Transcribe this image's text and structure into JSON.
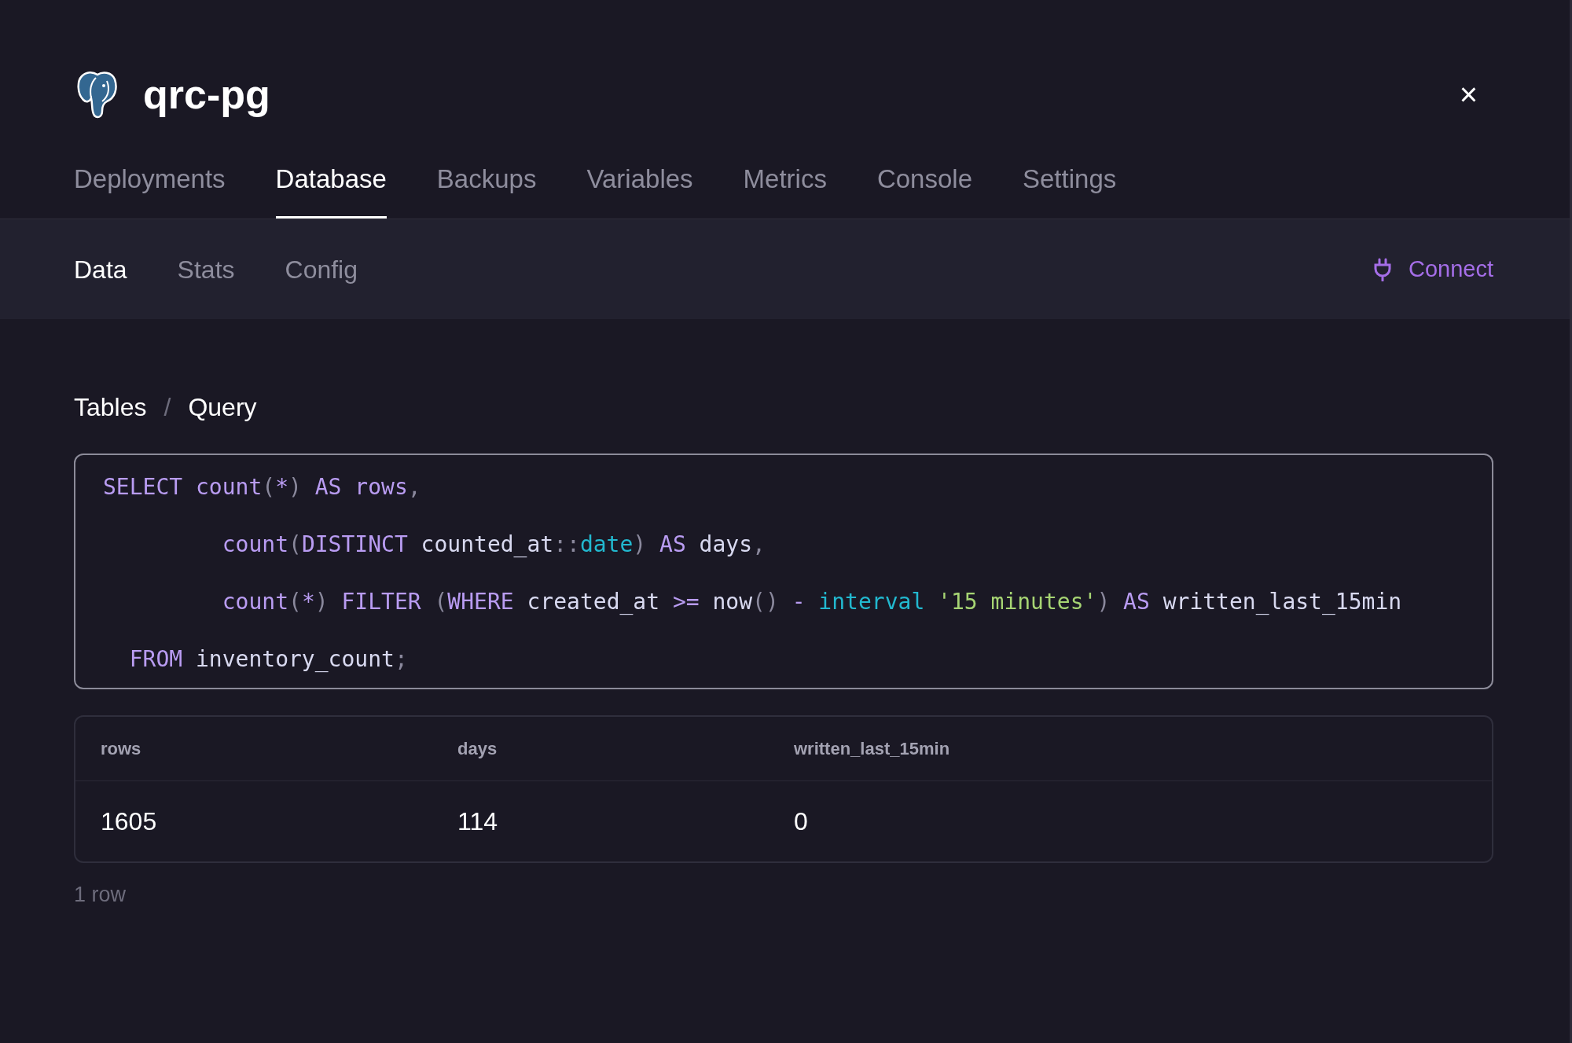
{
  "header": {
    "title": "qrc-pg",
    "close_label": "×"
  },
  "tabs": [
    {
      "label": "Deployments",
      "selected": false
    },
    {
      "label": "Database",
      "selected": true
    },
    {
      "label": "Backups",
      "selected": false
    },
    {
      "label": "Variables",
      "selected": false
    },
    {
      "label": "Metrics",
      "selected": false
    },
    {
      "label": "Console",
      "selected": false
    },
    {
      "label": "Settings",
      "selected": false
    }
  ],
  "subtabs": [
    {
      "label": "Data",
      "selected": true
    },
    {
      "label": "Stats",
      "selected": false
    },
    {
      "label": "Config",
      "selected": false
    }
  ],
  "connect_button": {
    "label": "Connect"
  },
  "breadcrumb": {
    "items": [
      "Tables",
      "Query"
    ],
    "separator": "/"
  },
  "query": {
    "lines": [
      [
        {
          "text": "SELECT",
          "kind": "keyword"
        },
        {
          "text": " count",
          "kind": "function"
        },
        {
          "text": "(",
          "kind": "punct"
        },
        {
          "text": "*",
          "kind": "operator"
        },
        {
          "text": ")",
          "kind": "punct"
        },
        {
          "text": " AS rows",
          "kind": "keyword"
        },
        {
          "text": ",",
          "kind": "punct"
        }
      ],
      [
        {
          "text": "         count",
          "kind": "function"
        },
        {
          "text": "(",
          "kind": "punct"
        },
        {
          "text": "DISTINCT",
          "kind": "keyword"
        },
        {
          "text": " counted_at",
          "kind": "ident"
        },
        {
          "text": "::",
          "kind": "punct"
        },
        {
          "text": "date",
          "kind": "type"
        },
        {
          "text": ")",
          "kind": "punct"
        },
        {
          "text": " AS",
          "kind": "keyword"
        },
        {
          "text": " days",
          "kind": "ident"
        },
        {
          "text": ",",
          "kind": "punct"
        }
      ],
      [
        {
          "text": "         count",
          "kind": "function"
        },
        {
          "text": "(",
          "kind": "punct"
        },
        {
          "text": "*",
          "kind": "operator"
        },
        {
          "text": ")",
          "kind": "punct"
        },
        {
          "text": " FILTER",
          "kind": "keyword"
        },
        {
          "text": " (",
          "kind": "punct"
        },
        {
          "text": "WHERE",
          "kind": "keyword"
        },
        {
          "text": " created_at ",
          "kind": "ident"
        },
        {
          "text": ">=",
          "kind": "operator"
        },
        {
          "text": " now",
          "kind": "ident"
        },
        {
          "text": "()",
          "kind": "punct"
        },
        {
          "text": " -",
          "kind": "operator"
        },
        {
          "text": " interval",
          "kind": "type"
        },
        {
          "text": " '15 minutes'",
          "kind": "string"
        },
        {
          "text": ")",
          "kind": "punct"
        },
        {
          "text": " AS",
          "kind": "keyword"
        },
        {
          "text": " written_last_15min",
          "kind": "ident"
        }
      ],
      [
        {
          "text": "  FROM",
          "kind": "keyword"
        },
        {
          "text": " inventory_count",
          "kind": "ident"
        },
        {
          "text": ";",
          "kind": "punct"
        }
      ]
    ]
  },
  "results": {
    "columns": [
      "rows",
      "days",
      "written_last_15min"
    ],
    "rows": [
      [
        "1605",
        "114",
        "0"
      ]
    ],
    "footer": "1 row"
  }
}
